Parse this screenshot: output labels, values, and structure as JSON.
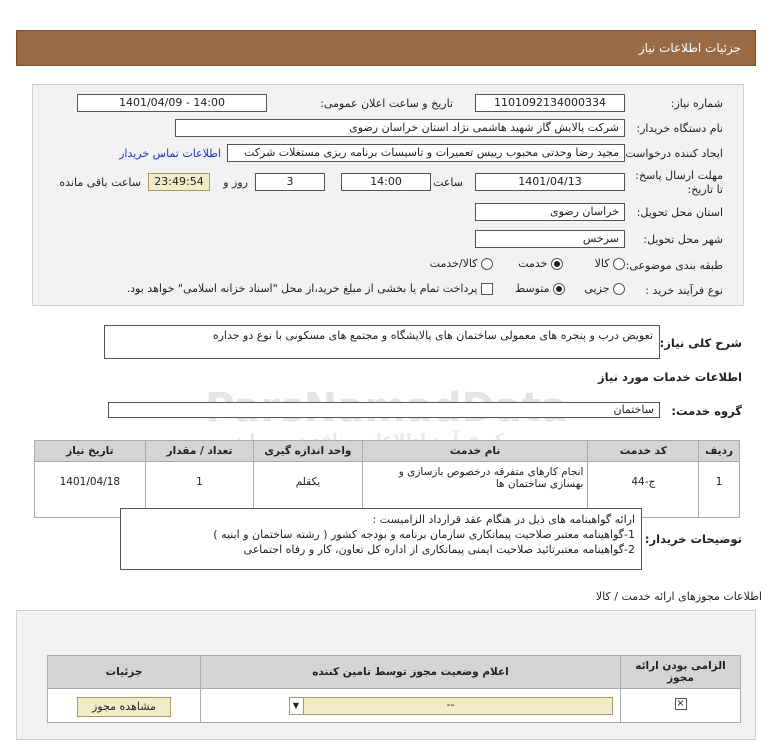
{
  "header": {
    "title": "جزئیات اطلاعات نیاز"
  },
  "form": {
    "need_number_label": "شماره نیاز:",
    "need_number": "1101092134000334",
    "announce_label": "تاریخ و ساعت اعلان عمومی:",
    "announce_value": "1401/04/09 - 14:00",
    "buyer_org_label": "نام دستگاه خریدار:",
    "buyer_org": "شرکت پالایش گاز شهید هاشمی نژاد   استان خراسان رضوی",
    "creator_label": "ایجاد کننده درخواست:",
    "creator": "مجید رضا وحدتی محبوب رییس تعمیرات و تاسیسات برنامه ریزی مستغلات شرکت",
    "contact_link": "اطلاعات تماس خریدار",
    "deadline_label": "مهلت ارسال پاسخ: تا تاریخ:",
    "deadline_date": "1401/04/13",
    "time_label": "ساعت",
    "deadline_time": "14:00",
    "days_value": "3",
    "days_label": "روز و",
    "remaining_time": "23:49:54",
    "remaining_label": "ساعت باقی مانده",
    "delivery_province_label": "استان محل تحویل:",
    "delivery_province": "خراسان رضوی",
    "delivery_city_label": "شهر محل تحویل:",
    "delivery_city": "سرخس",
    "category_label": "طبقه بندی موضوعی:",
    "category_options": [
      "کالا",
      "خدمت",
      "کالا/خدمت"
    ],
    "category_selected": "خدمت",
    "process_label": "نوع فرآیند خرید :",
    "process_options": [
      "جزیی",
      "متوسط"
    ],
    "process_selected": "متوسط",
    "payment_note": "پرداخت تمام یا بخشی از مبلغ خرید،از محل \"اسناد خزانه اسلامی\" خواهد بود."
  },
  "summary": {
    "label": "شرح کلی نیاز:",
    "text": "تعویض درب و پنجره های معمولی ساختمان های پالایشگاه و مجتمع های مسکونی با نوع دو جداره"
  },
  "services": {
    "title": "اطلاعات خدمات مورد نیاز",
    "group_label": "گروه خدمت:",
    "group_value": "ساختمان",
    "columns": [
      "ردیف",
      "کد خدمت",
      "نام خدمت",
      "واحد اندازه گیری",
      "تعداد / مقدار",
      "تاریخ نیاز"
    ],
    "rows": [
      {
        "index": "1",
        "code": "ج-44",
        "name": "انجام کارهای متفرقه درخصوص بازسازی و بهسازی ساختمان ها",
        "unit": "یکقلم",
        "qty": "1",
        "date": "1401/04/18"
      }
    ]
  },
  "buyer_notes": {
    "label": "توضیحات خریدار:",
    "lines": [
      "ارائه گواهینامه های ذیل در هنگام عقد قرارداد الزامیست :",
      "1-گواهینامه معتبر صلاحیت پیمانکاری سازمان برنامه و بودجه کشور ( رشته ساختمان و ابنیه )",
      "2-گواهینامه معتبرتائید صلاحیت ایمنی پیمانکاری از اداره کل تعاون، کار و رفاه اجتماعی"
    ]
  },
  "permits": {
    "title": "اطلاعات مجوزهای ارائه خدمت / کالا",
    "columns": [
      "الزامی بودن ارائه مجوز",
      "اعلام وضعیت مجوز توسط تامین کننده",
      "جزئیات"
    ],
    "status_value": "--",
    "view_button": "مشاهده مجوز"
  },
  "watermark": {
    "text1": "ParsNamadData",
    "text2": "مرکز فرآیند اطلاعات مناقصه و مزایده"
  }
}
